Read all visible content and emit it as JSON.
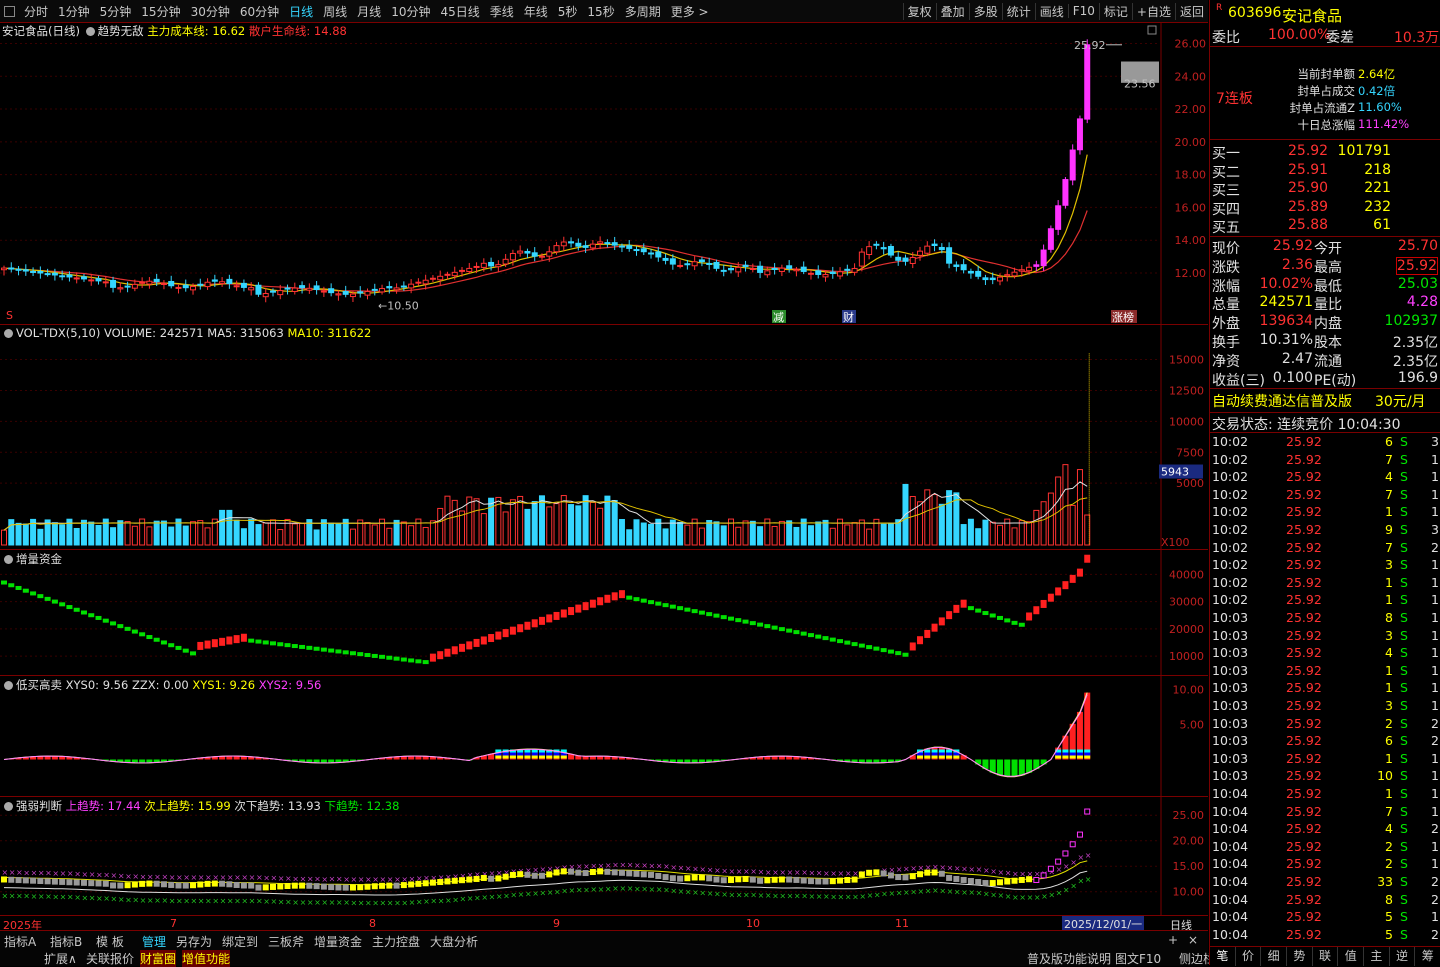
{
  "toolbar": {
    "periods": [
      "分时",
      "1分钟",
      "5分钟",
      "15分钟",
      "30分钟",
      "60分钟",
      "日线",
      "周线",
      "月线",
      "10分钟",
      "45日线",
      "季线",
      "年线",
      "5秒",
      "15秒",
      "多周期",
      "更多 >"
    ],
    "active": "日线",
    "right": [
      "复权",
      "叠加",
      "多股",
      "统计",
      "画线",
      "F10",
      "标记",
      "+自选",
      "返回"
    ]
  },
  "main": {
    "title": "安记食品(日线)",
    "indicator": "趋势无敌",
    "cost_label": "主力成本线: 16.62",
    "retail_label": "散户生命线: 14.88",
    "yaxis": [
      "26.00",
      "24.00",
      "22.00",
      "20.00",
      "18.00",
      "16.00",
      "14.00",
      "12.00"
    ],
    "high_label": "25.92",
    "mark_label": "23.56",
    "low_label": "10.50",
    "badges": [
      "减",
      "财",
      "涨榜"
    ],
    "s_mark": "S"
  },
  "vol": {
    "title": "VOL-TDX(5,10)",
    "volume": "VOLUME: 242571",
    "ma5": "MA5: 315063",
    "ma10": "MA10: 311622",
    "yaxis": [
      "15000",
      "12500",
      "10000",
      "7500",
      "5000"
    ],
    "mark": "5943",
    "unit": "X100"
  },
  "capital": {
    "title": "增量资金",
    "yaxis": [
      "40000",
      "30000",
      "20000",
      "10000"
    ]
  },
  "lowbuy": {
    "title": "低买高卖",
    "xys0": "XYS0: 9.56",
    "zzx": "ZZX: 0.00",
    "xys1": "XYS1: 9.26",
    "xys2": "XYS2: 9.56",
    "yaxis": [
      "10.00",
      "5.00"
    ]
  },
  "strength": {
    "title": "强弱判断",
    "up": "上趋势: 17.44",
    "up2": "次上趋势: 15.99",
    "down2": "次下趋势: 13.93",
    "down": "下趋势: 12.38",
    "yaxis": [
      "25.00",
      "20.00",
      "15.00",
      "10.00"
    ]
  },
  "dates": {
    "year": "2025年",
    "m7": "7",
    "m8": "8",
    "m9": "9",
    "m10": "10",
    "m11": "11",
    "cur": "2025/12/01/一",
    "period": "日线"
  },
  "bottom_tabs": [
    "指标A",
    "指标B",
    "模 板",
    "管理",
    "另存为",
    "绑定到",
    "三板斧",
    "增量资金",
    "主力控盘",
    "大盘分析"
  ],
  "bottom_tabs2": [
    "扩展∧",
    "关联报价",
    "财富圈",
    "增值功能"
  ],
  "bottom_right": [
    "普及版功能说明",
    "图文F10",
    "侧边栏»"
  ],
  "quote": {
    "code": "603696",
    "name": "安记食品",
    "r_mark": "R",
    "weibi_label": "委比",
    "weibi": "100.00%",
    "weicha_label": "委差",
    "weicha": "10.3万",
    "streak": "7连板",
    "info": [
      [
        "当前封单额",
        "2.64亿"
      ],
      [
        "封单占成交",
        "0.42倍"
      ],
      [
        "封单占流通Z",
        "11.60%"
      ],
      [
        "十日总涨幅",
        "111.42%"
      ]
    ],
    "bids": [
      [
        "买一",
        "25.92",
        "101791"
      ],
      [
        "买二",
        "25.91",
        "218"
      ],
      [
        "买三",
        "25.90",
        "221"
      ],
      [
        "买四",
        "25.89",
        "232"
      ],
      [
        "买五",
        "25.88",
        "61"
      ]
    ],
    "stats": [
      [
        "现价",
        "25.92",
        "今开",
        "25.70"
      ],
      [
        "涨跌",
        "2.36",
        "最高",
        "25.92"
      ],
      [
        "涨幅",
        "10.02%",
        "最低",
        "25.03"
      ],
      [
        "总量",
        "242571",
        "量比",
        "4.28"
      ],
      [
        "外盘",
        "139634",
        "内盘",
        "102937"
      ],
      [
        "换手",
        "10.31%",
        "股本",
        "2.35亿"
      ],
      [
        "净资",
        "2.47",
        "流通",
        "2.35亿"
      ],
      [
        "收益(三)",
        "0.100",
        "PE(动)",
        "196.9"
      ]
    ],
    "promo": "自动续费通达信普及版",
    "promo_price": "30元/月",
    "status": "交易状态: 连续竞价 10:04:30",
    "ticks": [
      [
        "10:02",
        "25.92",
        "6",
        "S",
        "3"
      ],
      [
        "10:02",
        "25.92",
        "7",
        "S",
        "1"
      ],
      [
        "10:02",
        "25.92",
        "4",
        "S",
        "1"
      ],
      [
        "10:02",
        "25.92",
        "7",
        "S",
        "1"
      ],
      [
        "10:02",
        "25.92",
        "1",
        "S",
        "1"
      ],
      [
        "10:02",
        "25.92",
        "9",
        "S",
        "3"
      ],
      [
        "10:02",
        "25.92",
        "7",
        "S",
        "2"
      ],
      [
        "10:02",
        "25.92",
        "3",
        "S",
        "1"
      ],
      [
        "10:02",
        "25.92",
        "1",
        "S",
        "1"
      ],
      [
        "10:02",
        "25.92",
        "1",
        "S",
        "1"
      ],
      [
        "10:03",
        "25.92",
        "8",
        "S",
        "1"
      ],
      [
        "10:03",
        "25.92",
        "3",
        "S",
        "1"
      ],
      [
        "10:03",
        "25.92",
        "4",
        "S",
        "1"
      ],
      [
        "10:03",
        "25.92",
        "1",
        "S",
        "1"
      ],
      [
        "10:03",
        "25.92",
        "1",
        "S",
        "1"
      ],
      [
        "10:03",
        "25.92",
        "3",
        "S",
        "1"
      ],
      [
        "10:03",
        "25.92",
        "2",
        "S",
        "2"
      ],
      [
        "10:03",
        "25.92",
        "6",
        "S",
        "2"
      ],
      [
        "10:03",
        "25.92",
        "1",
        "S",
        "1"
      ],
      [
        "10:03",
        "25.92",
        "10",
        "S",
        "1"
      ],
      [
        "10:04",
        "25.92",
        "1",
        "S",
        "1"
      ],
      [
        "10:04",
        "25.92",
        "7",
        "S",
        "1"
      ],
      [
        "10:04",
        "25.92",
        "4",
        "S",
        "2"
      ],
      [
        "10:04",
        "25.92",
        "2",
        "S",
        "1"
      ],
      [
        "10:04",
        "25.92",
        "2",
        "S",
        "1"
      ],
      [
        "10:04",
        "25.92",
        "33",
        "S",
        "2"
      ],
      [
        "10:04",
        "25.92",
        "8",
        "S",
        "2"
      ],
      [
        "10:04",
        "25.92",
        "5",
        "S",
        "1"
      ],
      [
        "10:04",
        "25.92",
        "5",
        "S",
        "2"
      ]
    ],
    "tabs": [
      "笔",
      "价",
      "细",
      "势",
      "联",
      "值",
      "主",
      "逆",
      "筹"
    ]
  }
}
